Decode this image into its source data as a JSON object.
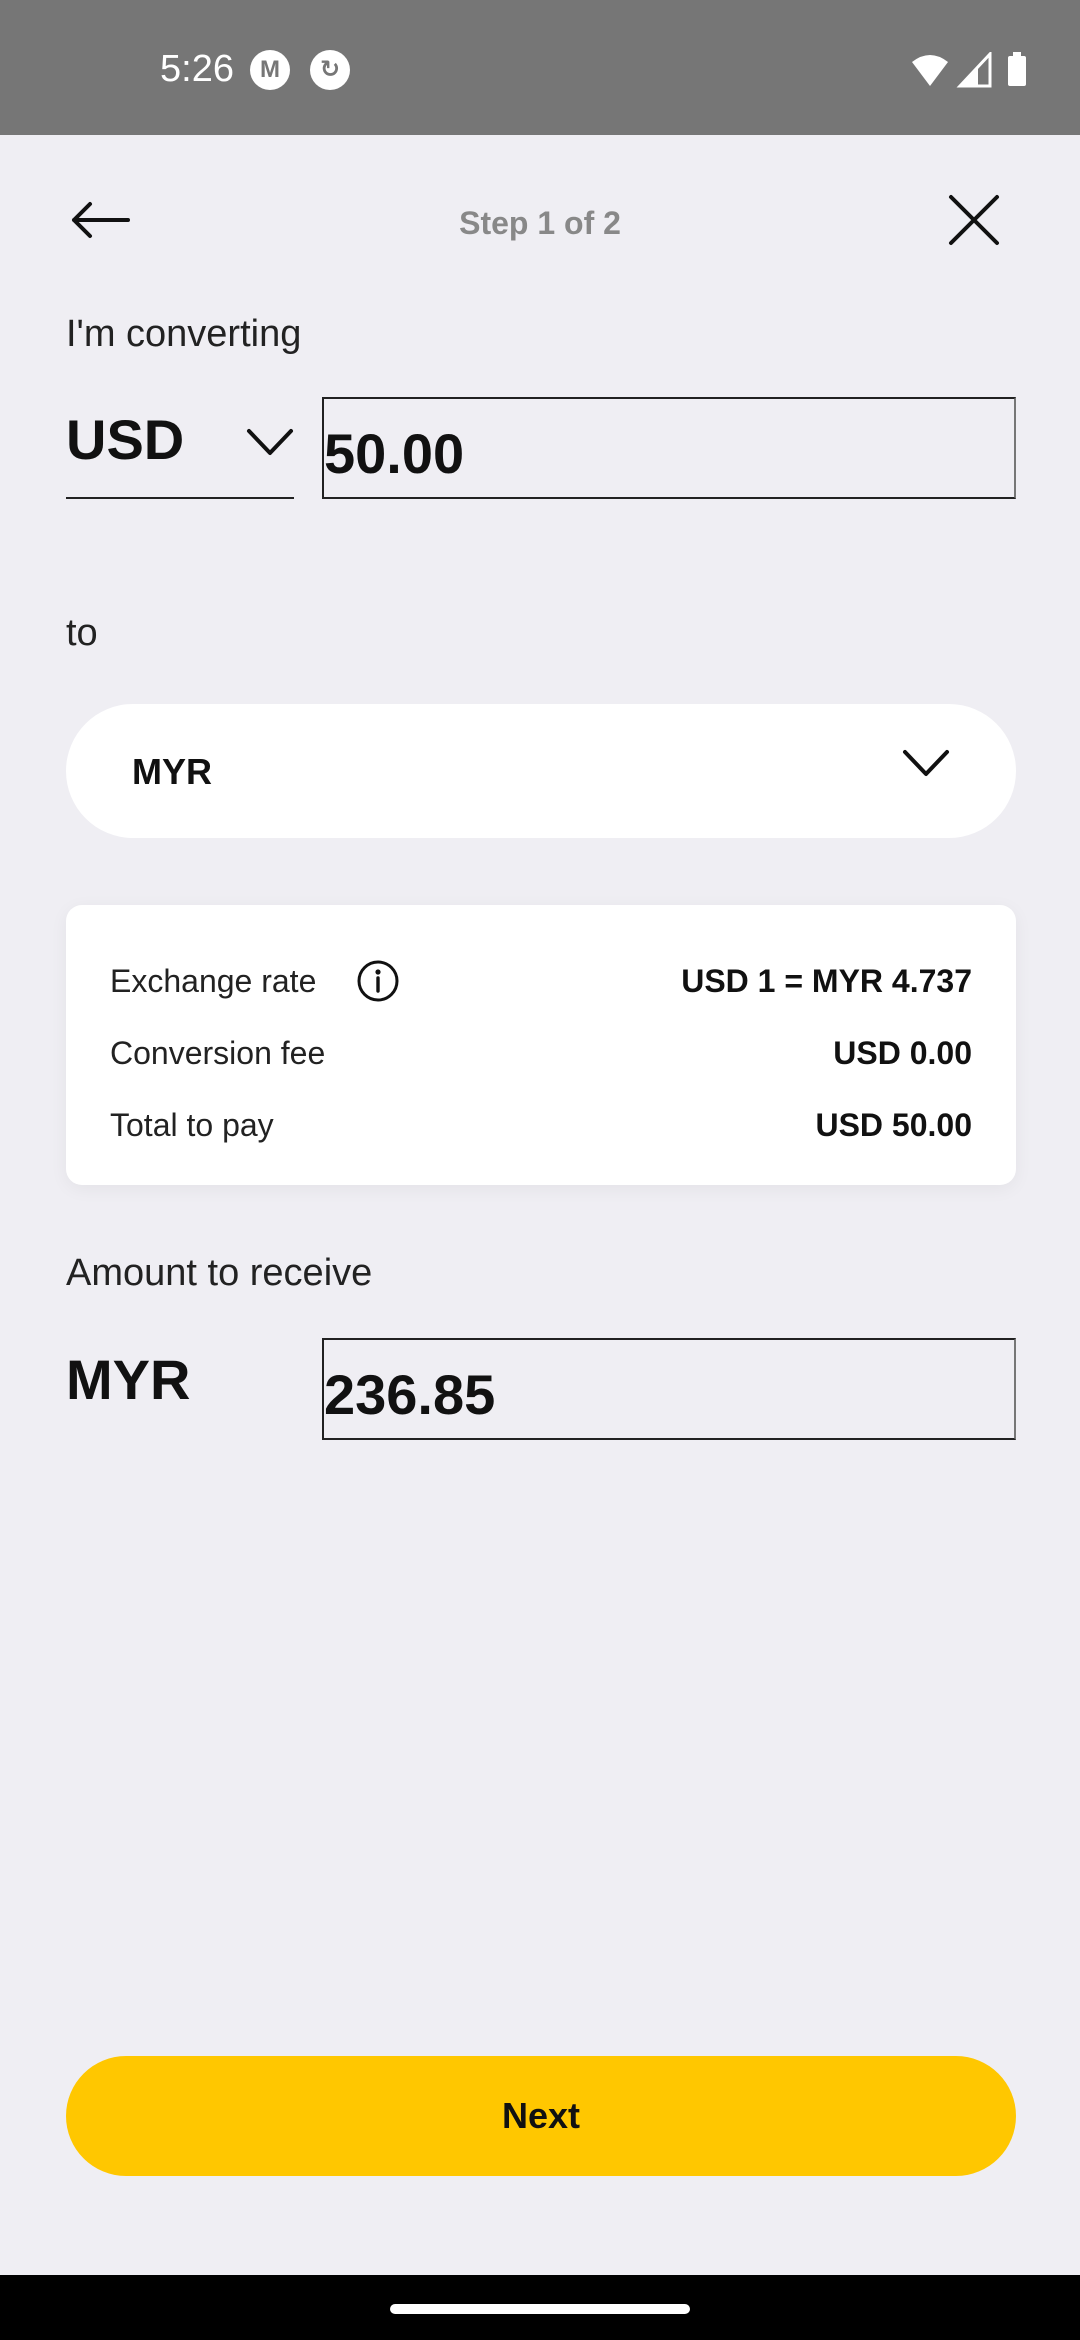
{
  "status_bar": {
    "time": "5:26",
    "app_icons": [
      "m-logo-icon",
      "refresh-logo-icon"
    ],
    "right_icons": [
      "wifi-icon",
      "cell-signal-icon",
      "battery-icon"
    ]
  },
  "header": {
    "step_label": "Step 1 of 2",
    "back_icon": "arrow-left-icon",
    "close_icon": "close-icon"
  },
  "from": {
    "label": "I'm converting",
    "currency": "USD",
    "amount": "50.00"
  },
  "to": {
    "label": "to",
    "currency": "MYR"
  },
  "rate_card": {
    "exchange_rate_label": "Exchange rate",
    "exchange_rate_value": "USD 1 = MYR 4.737",
    "conversion_fee_label": "Conversion fee",
    "conversion_fee_value": "USD 0.00",
    "total_label": "Total to pay",
    "total_value": "USD 50.00"
  },
  "receive": {
    "label": "Amount to receive",
    "currency": "MYR",
    "amount": "236.85"
  },
  "next_button": {
    "label": "Next"
  },
  "colors": {
    "background": "#efeef3",
    "accent": "#ffc700",
    "status_bar": "#767676"
  }
}
